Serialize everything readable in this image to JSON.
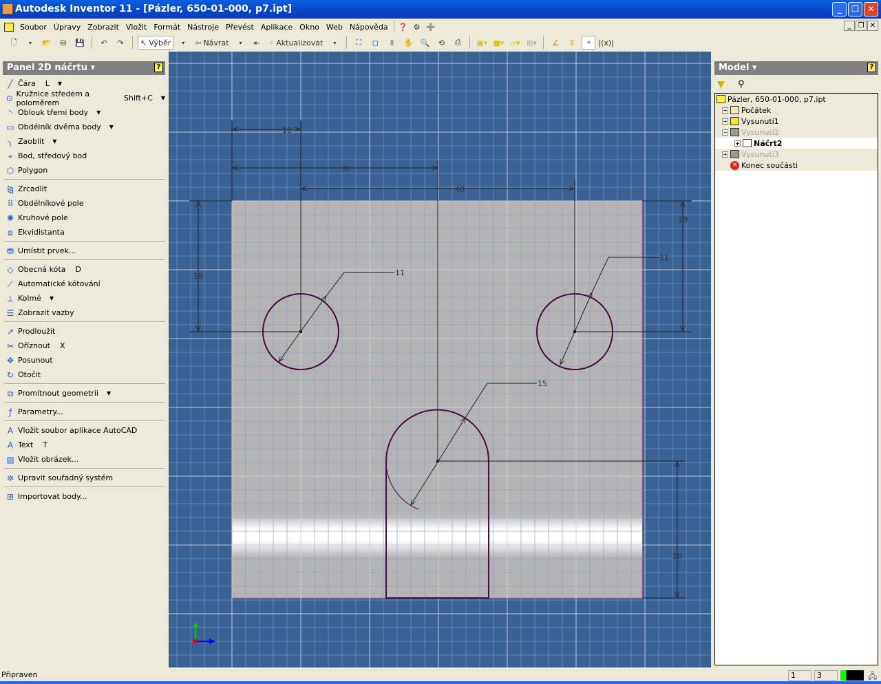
{
  "window": {
    "title": "Autodesk Inventor 11 - [Pázler, 650-01-000, p7.ipt]"
  },
  "menu": [
    "Soubor",
    "Úpravy",
    "Zobrazit",
    "Vložit",
    "Formát",
    "Nástroje",
    "Převést",
    "Aplikace",
    "Okno",
    "Web",
    "Nápověda"
  ],
  "toolbar": {
    "select_label": "Výběr",
    "return_label": "Návrat",
    "update_label": "Aktualizovat"
  },
  "left_panel": {
    "title": "Panel 2D náčrtu",
    "groups": [
      [
        {
          "label": "Čára",
          "shortcut": "L",
          "dropdown": true,
          "icon": "line-icon"
        },
        {
          "label": "Kružnice středem a poloměrem",
          "shortcut": "Shift+C",
          "dropdown": true,
          "icon": "circle-icon"
        },
        {
          "label": "Oblouk třemi body",
          "dropdown": true,
          "icon": "arc-icon"
        },
        {
          "label": "Obdélník dvěma body",
          "dropdown": true,
          "icon": "rectangle-icon"
        },
        {
          "label": "Zaoblit",
          "dropdown": true,
          "icon": "fillet-icon"
        },
        {
          "label": "Bod, středový bod",
          "icon": "point-icon"
        },
        {
          "label": "Polygon",
          "icon": "polygon-icon"
        }
      ],
      [
        {
          "label": "Zrcadlit",
          "icon": "mirror-icon"
        },
        {
          "label": "Obdélníkové pole",
          "icon": "rect-pattern-icon"
        },
        {
          "label": "Kruhové pole",
          "icon": "circ-pattern-icon"
        },
        {
          "label": "Ekvidistanta",
          "icon": "offset-icon"
        }
      ],
      [
        {
          "label": "Umístit prvek...",
          "icon": "place-feature-icon"
        }
      ],
      [
        {
          "label": "Obecná kóta",
          "shortcut": "D",
          "icon": "dimension-icon"
        },
        {
          "label": "Automatické kótování",
          "icon": "auto-dimension-icon"
        },
        {
          "label": "Kolmé",
          "dropdown": true,
          "icon": "perpendicular-icon"
        },
        {
          "label": "Zobrazit vazby",
          "icon": "show-constraints-icon"
        }
      ],
      [
        {
          "label": "Prodloužit",
          "icon": "extend-icon"
        },
        {
          "label": "Oříznout",
          "shortcut": "X",
          "icon": "trim-icon"
        },
        {
          "label": "Posunout",
          "icon": "move-icon"
        },
        {
          "label": "Otočit",
          "icon": "rotate-icon"
        }
      ],
      [
        {
          "label": "Promítnout geometrii",
          "dropdown": true,
          "icon": "project-geometry-icon"
        }
      ],
      [
        {
          "label": "Parametry...",
          "icon": "parameters-icon"
        }
      ],
      [
        {
          "label": "Vložit soubor aplikace AutoCAD",
          "icon": "autocad-icon"
        },
        {
          "label": "Text",
          "shortcut": "T",
          "icon": "text-icon"
        },
        {
          "label": "Vložit obrázek...",
          "icon": "image-icon"
        }
      ],
      [
        {
          "label": "Upravit souřadný systém",
          "icon": "coordinate-system-icon"
        }
      ],
      [
        {
          "label": "Importovat body...",
          "icon": "import-points-icon"
        }
      ]
    ]
  },
  "model_panel": {
    "title": "Model",
    "tree": [
      {
        "label": "Pázler, 650-01-000, p7.ipt",
        "level": 0
      },
      {
        "label": "Počátek",
        "level": 1,
        "expander": "+"
      },
      {
        "label": "Vysunutí1",
        "level": 1,
        "expander": "+"
      },
      {
        "label": "Vysunutí2",
        "level": 1,
        "expander": "-",
        "dim": true
      },
      {
        "label": "Náčrt2",
        "level": 2,
        "expander": "+",
        "selected": true
      },
      {
        "label": "Vysunutí3",
        "level": 1,
        "expander": "+",
        "dim": true
      },
      {
        "label": "Konec součásti",
        "level": 1,
        "end": true
      }
    ]
  },
  "sketch": {
    "dimensions": {
      "d10": "10",
      "d30": "30",
      "d40": "40",
      "d19_left": "19",
      "d19_right": "19",
      "d11_left": "11",
      "d11_right": "11",
      "d15": "15",
      "d20": "20"
    }
  },
  "status": {
    "text": "Připraven",
    "box1": "1",
    "box2": "3"
  },
  "colors": {
    "canvas": "#3a6193",
    "part": "#b4b4b4",
    "sketch": "#4a0a40",
    "dimension": "#222222"
  }
}
